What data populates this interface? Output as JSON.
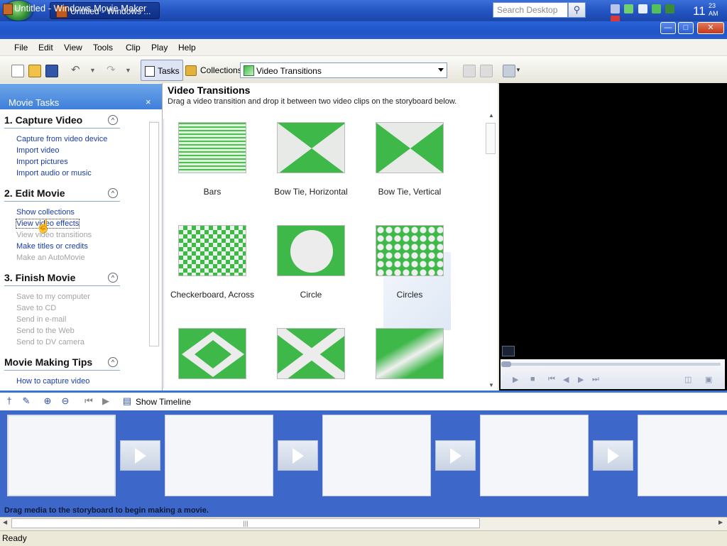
{
  "taskbar": {
    "task_button": "Untitled - Windows ...",
    "search_placeholder": "Search Desktop",
    "clock_hour": "11",
    "clock_minute": "23",
    "clock_ampm": "AM"
  },
  "window": {
    "title": "Untitled - Windows Movie Maker"
  },
  "menu": {
    "items": [
      "File",
      "Edit",
      "View",
      "Tools",
      "Clip",
      "Play",
      "Help"
    ]
  },
  "toolbar": {
    "tasks_label": "Tasks",
    "collections_label": "Collections:",
    "collections_selected": "Video Transitions"
  },
  "tasks_pane": {
    "title": "Movie Tasks",
    "close_glyph": "×",
    "sections": [
      {
        "title": "1. Capture Video",
        "links": [
          {
            "label": "Capture from video device",
            "enabled": true
          },
          {
            "label": "Import video",
            "enabled": true
          },
          {
            "label": "Import pictures",
            "enabled": true
          },
          {
            "label": "Import audio or music",
            "enabled": true
          }
        ]
      },
      {
        "title": "2. Edit Movie",
        "links": [
          {
            "label": "Show collections",
            "enabled": true
          },
          {
            "label": "View video effects",
            "enabled": true
          },
          {
            "label": "View video transitions",
            "enabled": false
          },
          {
            "label": "Make titles or credits",
            "enabled": true
          },
          {
            "label": "Make an AutoMovie",
            "enabled": false
          }
        ]
      },
      {
        "title": "3. Finish Movie",
        "links": [
          {
            "label": "Save to my computer",
            "enabled": false
          },
          {
            "label": "Save to CD",
            "enabled": false
          },
          {
            "label": "Send in e-mail",
            "enabled": false
          },
          {
            "label": "Send to the Web",
            "enabled": false
          },
          {
            "label": "Send to DV camera",
            "enabled": false
          }
        ]
      },
      {
        "title": "Movie Making Tips",
        "links": [
          {
            "label": "How to capture video",
            "enabled": true
          }
        ]
      }
    ]
  },
  "collection": {
    "title": "Video Transitions",
    "subtitle": "Drag a video transition and drop it between two video clips on the storyboard below.",
    "items": [
      {
        "label": "Bars",
        "icon": "bars-transition-icon"
      },
      {
        "label": "Bow Tie, Horizontal",
        "icon": "bow-tie-horizontal-icon"
      },
      {
        "label": "Bow Tie, Vertical",
        "icon": "bow-tie-vertical-icon"
      },
      {
        "label": "Checkerboard, Across",
        "icon": "checkerboard-icon"
      },
      {
        "label": "Circle",
        "icon": "circle-transition-icon"
      },
      {
        "label": "Circles",
        "icon": "circles-transition-icon"
      },
      {
        "label": "",
        "icon": "diamond-transition-icon"
      },
      {
        "label": "",
        "icon": "diagonal-cross-icon"
      },
      {
        "label": "",
        "icon": "diagonal-fade-icon"
      }
    ]
  },
  "storyboard": {
    "show_timeline_label": "Show Timeline",
    "message": "Drag media to the storyboard to begin making a movie."
  },
  "status": {
    "text": "Ready"
  },
  "colors": {
    "accent_blue": "#3d68c9",
    "transition_green": "#3fb84a",
    "link_blue": "#1a3ca8"
  }
}
